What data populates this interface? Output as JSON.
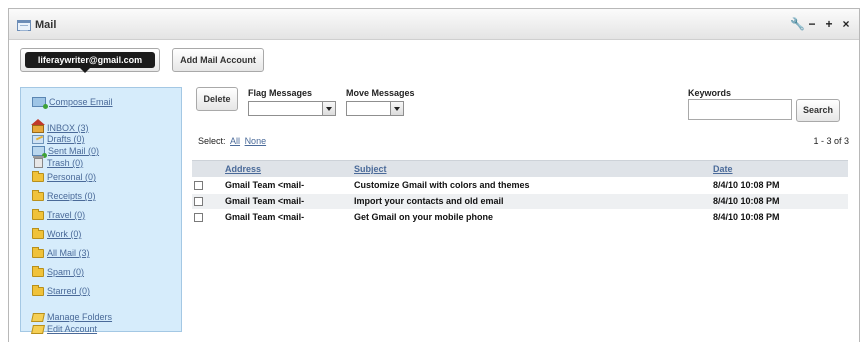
{
  "portlet": {
    "title": "Mail",
    "controls": [
      "🔧",
      "−",
      "+",
      "×"
    ]
  },
  "account": {
    "email": "liferaywriter@gmail.com",
    "add_label": "Add Mail Account"
  },
  "sidebar": {
    "compose": "Compose Email",
    "folders": [
      {
        "label": "INBOX (3)",
        "icon": "home-icon"
      },
      {
        "label": "Drafts (0)",
        "icon": "drafts-icon"
      },
      {
        "label": "Sent Mail (0)",
        "icon": "sent-mail-icon"
      },
      {
        "label": "Trash (0)",
        "icon": "trash-icon"
      },
      {
        "label": "Personal (0)",
        "icon": "folder-icon"
      },
      {
        "label": "Receipts (0)",
        "icon": "folder-icon"
      },
      {
        "label": "Travel (0)",
        "icon": "folder-icon"
      },
      {
        "label": "Work (0)",
        "icon": "folder-icon"
      },
      {
        "label": "All Mail (3)",
        "icon": "folder-icon"
      },
      {
        "label": "Spam (0)",
        "icon": "folder-icon"
      },
      {
        "label": "Starred (0)",
        "icon": "folder-icon"
      }
    ],
    "manage_folders": "Manage Folders",
    "edit_account": "Edit Account"
  },
  "toolbar": {
    "delete_label": "Delete",
    "flag_label": "Flag Messages",
    "flag_value": "",
    "move_label": "Move Messages",
    "move_value": "",
    "keywords_label": "Keywords",
    "keywords_value": "",
    "search_label": "Search"
  },
  "selection": {
    "prefix": "Select:",
    "all": "All",
    "none": "None",
    "pager": "1 - 3 of 3"
  },
  "table": {
    "headers": {
      "address": "Address",
      "subject": "Subject",
      "date": "Date"
    },
    "rows": [
      {
        "address": "Gmail Team <mail-",
        "subject": "Customize Gmail with colors and themes",
        "date": "8/4/10 10:08 PM"
      },
      {
        "address": "Gmail Team <mail-",
        "subject": "Import your contacts and old email",
        "date": "8/4/10 10:08 PM"
      },
      {
        "address": "Gmail Team <mail-",
        "subject": "Get Gmail on your mobile phone",
        "date": "8/4/10 10:08 PM"
      }
    ]
  },
  "colors": {
    "sidebar_bg": "#d6ecfb",
    "link": "#4a6a99",
    "account_badge": "#1b1b1b",
    "table_header": "#dfe3e8"
  }
}
